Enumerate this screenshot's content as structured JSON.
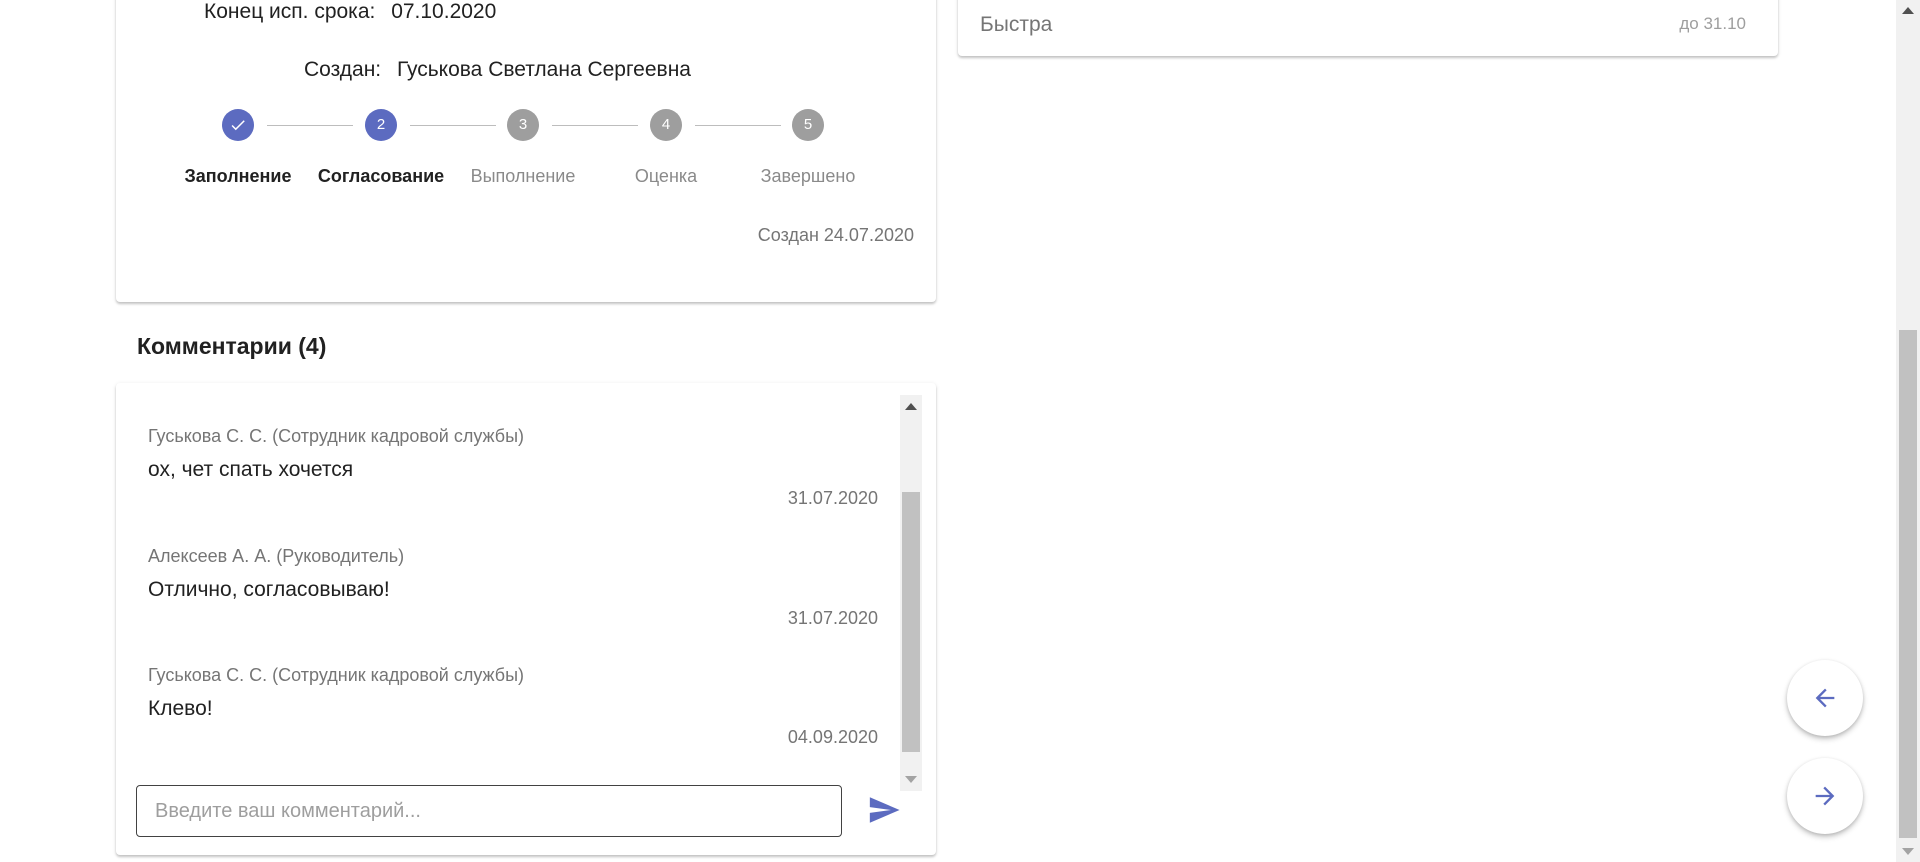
{
  "info_card": {
    "end_label": "Конец исп. срока:",
    "end_value": "07.10.2020",
    "created_label": "Создан:",
    "created_value": "Гуськова Светлана Сергеевна",
    "steps": [
      {
        "number": "",
        "label": "Заполнение",
        "state": "done"
      },
      {
        "number": "2",
        "label": "Согласование",
        "state": "active"
      },
      {
        "number": "3",
        "label": "Выполнение",
        "state": "pending"
      },
      {
        "number": "4",
        "label": "Оценка",
        "state": "pending"
      },
      {
        "number": "5",
        "label": "Завершено",
        "state": "pending"
      }
    ],
    "created_date": "Создан 24.07.2020"
  },
  "right_card": {
    "name": "Быстра",
    "due": "до 31.10"
  },
  "comments": {
    "title": "Комментарии (4)",
    "items": [
      {
        "author": "Гуськова С. С. (Сотрудник кадровой службы)",
        "text": "ох, чет спать хочется",
        "date": "31.07.2020"
      },
      {
        "author": "Алексеев А. А. (Руководитель)",
        "text": "Отлично, согласовываю!",
        "date": "31.07.2020"
      },
      {
        "author": "Гуськова С. С. (Сотрудник кадровой службы)",
        "text": "Клево!",
        "date": "04.09.2020"
      }
    ],
    "input_placeholder": "Введите ваш комментарий..."
  },
  "icons": {
    "step_done": "check-icon",
    "send": "send-icon",
    "prev": "arrow-left-icon",
    "next": "arrow-right-icon"
  },
  "colors": {
    "accent": "#5c6bc0",
    "step_inactive": "#9e9e9e"
  }
}
